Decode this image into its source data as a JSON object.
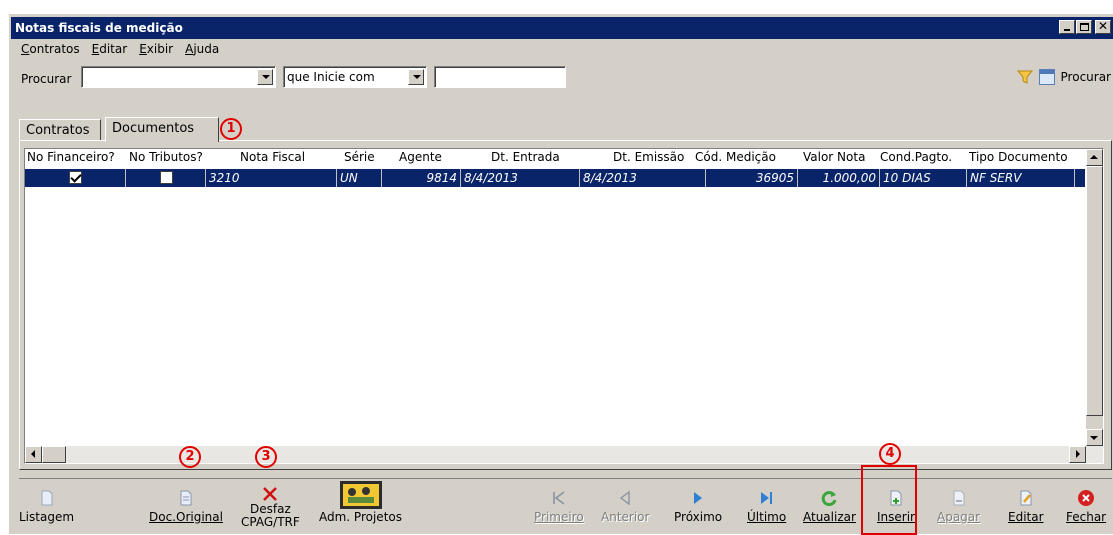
{
  "window": {
    "title": "Notas fiscais de medição"
  },
  "menu": [
    "Contratos",
    "Editar",
    "Exibir",
    "Ajuda"
  ],
  "search": {
    "label": "Procurar",
    "field_value": "",
    "mode_value": "que Inicie com",
    "text_value": "",
    "button_label": "Procurar"
  },
  "tabs": [
    {
      "label": "Contratos",
      "active": false
    },
    {
      "label": "Documentos",
      "active": true
    }
  ],
  "grid": {
    "columns": [
      "No Financeiro?",
      "No Tributos?",
      "Nota Fiscal",
      "Série",
      "Agente",
      "Dt. Entrada",
      "Dt. Emissão",
      "Cód. Medição",
      "Valor Nota",
      "Cond.Pagto.",
      "Tipo Documento"
    ],
    "rows": [
      {
        "no_financeiro": true,
        "no_tributos": false,
        "nota_fiscal": "3210",
        "serie": "UN",
        "agente": "9814",
        "dt_entrada": "8/4/2013",
        "dt_emissao": "8/4/2013",
        "cod_medicao": "36905",
        "valor_nota": "1.000,00",
        "cond_pagto": "10 DIAS",
        "tipo_documento": "NF SERV"
      }
    ]
  },
  "toolbar": {
    "listagem": "Listagem",
    "doc_original": "Doc.Original",
    "desfaz_1": "Desfaz",
    "desfaz_2": "CPAG/TRF",
    "adm_projetos": "Adm. Projetos",
    "primeiro": "Primeiro",
    "anterior": "Anterior",
    "proximo": "Próximo",
    "ultimo": "Último",
    "atualizar": "Atualizar",
    "inserir": "Inserir",
    "apagar": "Apagar",
    "editar": "Editar",
    "fechar": "Fechar"
  },
  "annotations": [
    "1",
    "2",
    "3",
    "4"
  ],
  "colors": {
    "titlebar": "#0a246a",
    "selection": "#0a246a",
    "window_bg": "#d4d0c8",
    "annotation": "#e00000"
  }
}
